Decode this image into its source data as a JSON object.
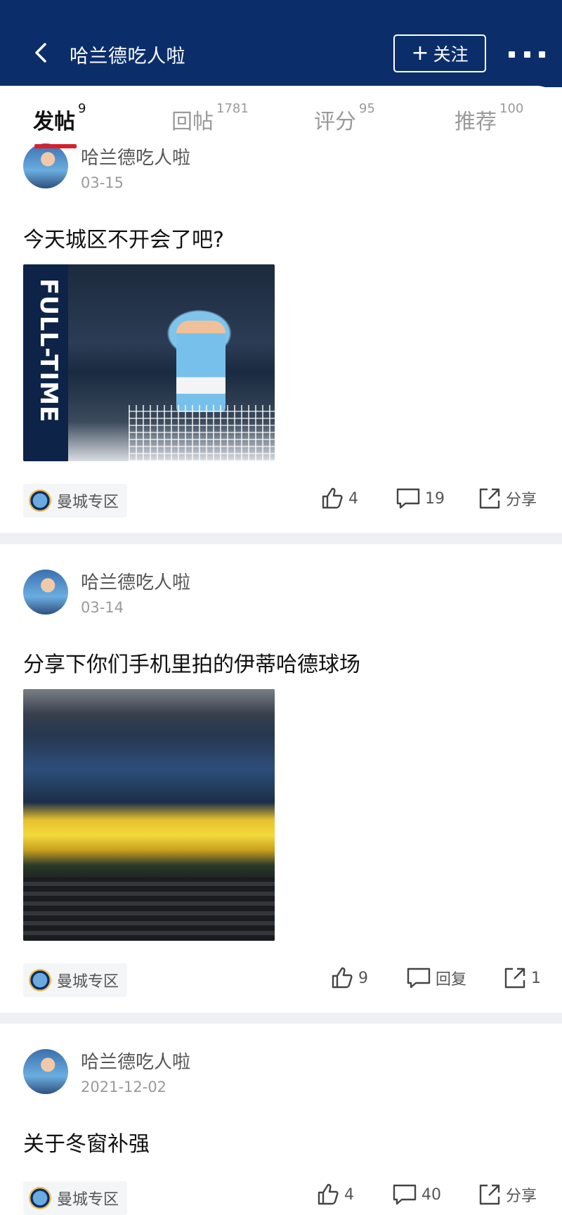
{
  "header": {
    "title": "哈兰德吃人啦",
    "follow_label": "关注",
    "follow_plus": "+"
  },
  "tabs": [
    {
      "label": "发帖",
      "count": "9",
      "active": true
    },
    {
      "label": "回帖",
      "count": "1781",
      "active": false
    },
    {
      "label": "评分",
      "count": "95",
      "active": false
    },
    {
      "label": "推荐",
      "count": "100",
      "active": false
    }
  ],
  "posts": [
    {
      "author": "哈兰德吃人啦",
      "date": "03-15",
      "title": "今天城区不开会了吧?",
      "image_text": "FULL-TIME",
      "tag": "曼城专区",
      "likes": "4",
      "comments": "19",
      "share": "分享"
    },
    {
      "author": "哈兰德吃人啦",
      "date": "03-14",
      "title": "分享下你们手机里拍的伊蒂哈德球场",
      "tag": "曼城专区",
      "likes": "9",
      "comments": "回复",
      "share": "1"
    },
    {
      "author": "哈兰德吃人啦",
      "date": "2021-12-02",
      "title": "关于冬窗补强",
      "tag": "曼城专区",
      "likes": "4",
      "comments": "40",
      "share": "分享"
    }
  ],
  "colors": {
    "header_bg": "#0b2e6b",
    "tab_indicator": "#d8202a"
  }
}
